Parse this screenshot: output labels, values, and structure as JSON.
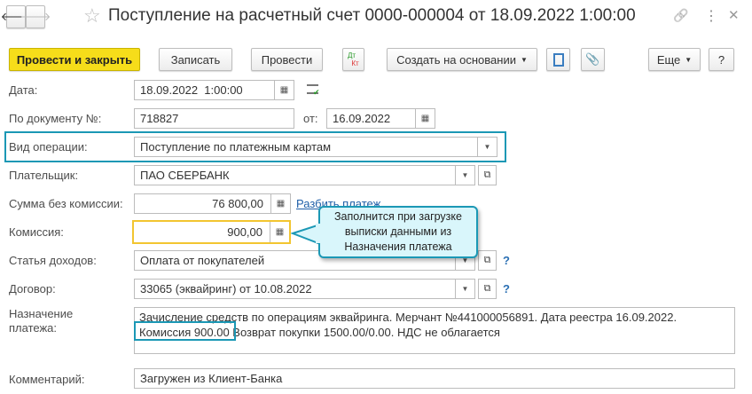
{
  "header": {
    "title": "Поступление на расчетный счет 0000-000004 от 18.09.2022 1:00:00",
    "back": "🡐",
    "forward": "🡒",
    "star": "☆",
    "link": "🔗",
    "more": "⋮",
    "close": "✕"
  },
  "toolbar": {
    "post_close": "Провести и закрыть",
    "save": "Записать",
    "post": "Провести",
    "dt": "Дт",
    "kt": "Кт",
    "create_based": "Создать на основании",
    "more": "Еще",
    "help": "?"
  },
  "form": {
    "date": {
      "label": "Дата:",
      "value": "18.09.2022  1:00:00"
    },
    "doc_number": {
      "label": "По документу №:",
      "value": "718827",
      "from_label": "от:",
      "from_value": "16.09.2022"
    },
    "operation": {
      "label": "Вид операции:",
      "value": "Поступление по платежным картам"
    },
    "payer": {
      "label": "Плательщик:",
      "value": "ПАО СБЕРБАНК"
    },
    "amount": {
      "label": "Сумма без комиссии:",
      "value": "76 800,00",
      "split_link": "Разбить платеж"
    },
    "commission": {
      "label": "Комиссия:",
      "value": "900,00"
    },
    "income_item": {
      "label": "Статья доходов:",
      "value": "Оплата от покупателей",
      "help": "?"
    },
    "contract": {
      "label": "Договор:",
      "value": "33065 (эквайринг) от 10.08.2022",
      "help": "?"
    },
    "purpose": {
      "label": "Назначение платежа:",
      "line1": "Зачисление средств по операциям эквайринга. Мерчант №441000056891. Дата реестра 16.09.2022.",
      "line2_highlight": "Комиссия 900.00",
      "line2_rest": " Возврат покупки 1500.00/0.00. НДС не облагается"
    },
    "comment": {
      "label": "Комментарий:",
      "value": "Загружен из Клиент-Банка"
    }
  },
  "callout": {
    "text": "Заполнится при загрузке выписки данными из Назначения платежа"
  },
  "colors": {
    "primary": "#f6dd1a",
    "highlight": "#1b98b5",
    "callout_bg": "#d9f6fb",
    "commission_border": "#f2c530"
  }
}
